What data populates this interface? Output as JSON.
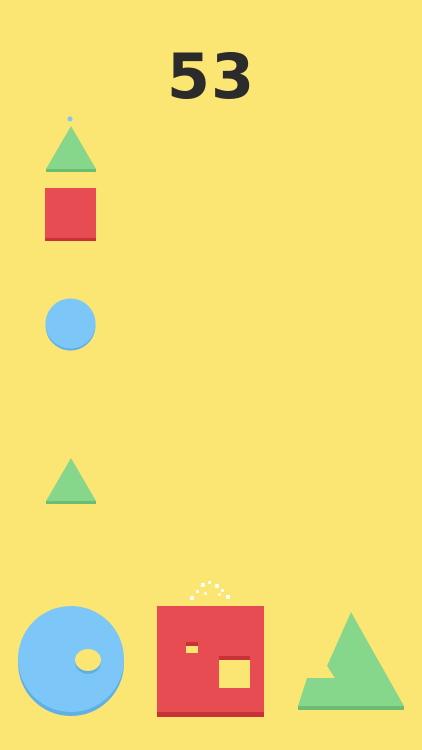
{
  "game": {
    "score": "53",
    "background_color": "#fbe573",
    "colors": {
      "red": "#e64c52",
      "red_shade": "#c73238",
      "green": "#86d68c",
      "green_shade": "#6bbd72",
      "blue": "#7cc7f7",
      "blue_shade": "#5fb0e6",
      "text": "#2b2b2b"
    },
    "falling_shapes": [
      {
        "shape": "triangle",
        "color": "green"
      },
      {
        "shape": "square",
        "color": "red"
      },
      {
        "shape": "circle",
        "color": "blue"
      },
      {
        "shape": "triangle",
        "color": "green"
      }
    ],
    "catchers": [
      {
        "shape": "circle",
        "color": "blue"
      },
      {
        "shape": "square",
        "color": "red"
      },
      {
        "shape": "triangle",
        "color": "green"
      }
    ]
  }
}
